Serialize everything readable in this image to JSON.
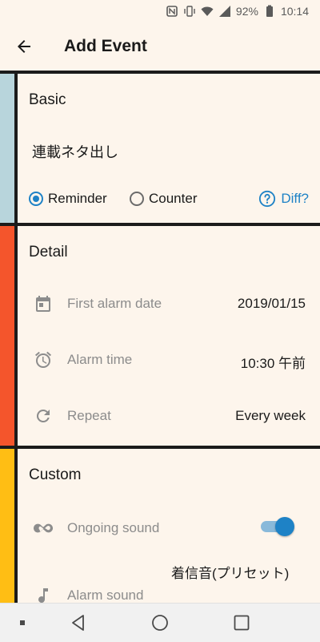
{
  "status_bar": {
    "battery": "92%",
    "time": "10:14",
    "icons": [
      "nfc-icon",
      "vibrate-icon",
      "wifi-icon",
      "signal-icon",
      "battery-icon"
    ]
  },
  "app_bar": {
    "title": "Add Event",
    "back_icon": "arrow-back-icon"
  },
  "basic": {
    "heading": "Basic",
    "event_name": "連載ネタ出し",
    "options": [
      {
        "label": "Reminder",
        "selected": true
      },
      {
        "label": "Counter",
        "selected": false
      }
    ],
    "diff_label": "Diff?",
    "accent_color": "#b8d5dc"
  },
  "detail": {
    "heading": "Detail",
    "accent_color": "#f4552c",
    "rows": [
      {
        "icon": "calendar-icon",
        "label": "First alarm date",
        "value": "2019/01/15"
      },
      {
        "icon": "alarm-clock-icon",
        "label": "Alarm time",
        "value": "10:30 午前"
      },
      {
        "icon": "repeat-icon",
        "label": "Repeat",
        "value": "Every week"
      }
    ]
  },
  "custom": {
    "heading": "Custom",
    "accent_color": "#ffbe14",
    "ongoing_sound": {
      "icon": "infinity-icon",
      "label": "Ongoing sound",
      "enabled": true
    },
    "alarm_sound": {
      "icon": "music-note-icon",
      "label": "Alarm sound",
      "value": "着信音(プリセット)"
    }
  },
  "colors": {
    "accent": "#1e82c6",
    "background": "#fdf5ec",
    "divider": "#1b1b1b"
  },
  "nav_bar": {
    "buttons": [
      "recents-dot-icon",
      "back-triangle-icon",
      "home-circle-icon",
      "overview-square-icon"
    ]
  }
}
